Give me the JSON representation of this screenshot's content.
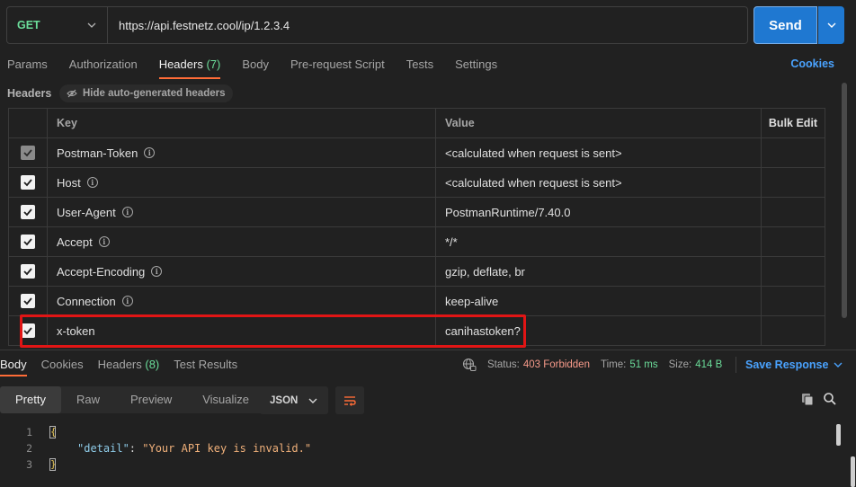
{
  "request": {
    "method": "GET",
    "url": "https://api.festnetz.cool/ip/1.2.3.4",
    "send_label": "Send"
  },
  "request_tabs": [
    {
      "label": "Params"
    },
    {
      "label": "Authorization"
    },
    {
      "label": "Headers",
      "count": "(7)"
    },
    {
      "label": "Body"
    },
    {
      "label": "Pre-request Script"
    },
    {
      "label": "Tests"
    },
    {
      "label": "Settings"
    }
  ],
  "cookies_label": "Cookies",
  "headers_section": {
    "title": "Headers",
    "hide_auto_label": "Hide auto-generated headers"
  },
  "table": {
    "col_key": "Key",
    "col_value": "Value",
    "bulk_edit": "Bulk Edit",
    "rows": [
      {
        "key": "Postman-Token",
        "value": "<calculated when request is sent>"
      },
      {
        "key": "Host",
        "value": "<calculated when request is sent>"
      },
      {
        "key": "User-Agent",
        "value": "PostmanRuntime/7.40.0"
      },
      {
        "key": "Accept",
        "value": "*/*"
      },
      {
        "key": "Accept-Encoding",
        "value": "gzip, deflate, br"
      },
      {
        "key": "Connection",
        "value": "keep-alive"
      },
      {
        "key": "x-token",
        "value": "canihastoken?"
      }
    ]
  },
  "response_tabs": [
    {
      "label": "Body"
    },
    {
      "label": "Cookies"
    },
    {
      "label": "Headers",
      "count": "(8)"
    },
    {
      "label": "Test Results"
    }
  ],
  "status": {
    "status_label": "Status:",
    "status_value": "403 Forbidden",
    "time_label": "Time:",
    "time_value": "51 ms",
    "size_label": "Size:",
    "size_value": "414 B"
  },
  "save_response": "Save Response",
  "format_tabs": [
    "Pretty",
    "Raw",
    "Preview",
    "Visualize"
  ],
  "format_select": "JSON",
  "code_lines": [
    {
      "n": "1",
      "key": "",
      "value": ""
    },
    {
      "n": "2",
      "key": "\"detail\"",
      "value": "\"Your API key is invalid.\""
    },
    {
      "n": "3",
      "key": "",
      "value": ""
    }
  ],
  "colors": {
    "accent_orange": "#ff6c37",
    "send_blue": "#1f78d1",
    "link_blue": "#4aa3ff",
    "method_green": "#6bdd9a",
    "highlight_red": "#e11515"
  }
}
